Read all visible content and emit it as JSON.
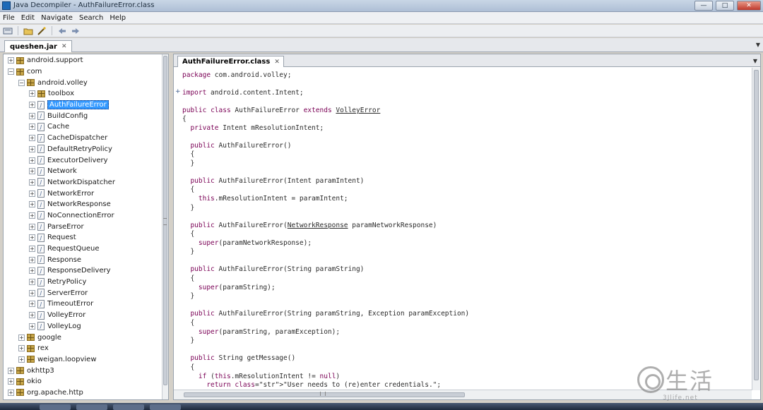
{
  "window": {
    "title": "Java Decompiler - AuthFailureError.class",
    "buttons": [
      "—",
      "□",
      "✕"
    ]
  },
  "menu": [
    "File",
    "Edit",
    "Navigate",
    "Search",
    "Help"
  ],
  "toolbar": {
    "icons": [
      "open-icon",
      "open-folder-icon",
      "wand-icon",
      "back-icon",
      "forward-icon"
    ]
  },
  "jar_tab": {
    "label": "queshen.jar",
    "close": "✕"
  },
  "tree": {
    "rows": [
      {
        "label": "android.support",
        "indent": 0,
        "expander": "+",
        "icon": "pkg"
      },
      {
        "label": "com",
        "indent": 0,
        "expander": "−",
        "icon": "pkg"
      },
      {
        "label": "android.volley",
        "indent": 1,
        "expander": "−",
        "icon": "pkg"
      },
      {
        "label": "toolbox",
        "indent": 2,
        "expander": "+",
        "icon": "pkg"
      },
      {
        "label": "AuthFailureError",
        "indent": 2,
        "expander": "+",
        "icon": "file",
        "selected": true
      },
      {
        "label": "BuildConfig",
        "indent": 2,
        "expander": "+",
        "icon": "file"
      },
      {
        "label": "Cache",
        "indent": 2,
        "expander": "+",
        "icon": "file"
      },
      {
        "label": "CacheDispatcher",
        "indent": 2,
        "expander": "+",
        "icon": "file"
      },
      {
        "label": "DefaultRetryPolicy",
        "indent": 2,
        "expander": "+",
        "icon": "file"
      },
      {
        "label": "ExecutorDelivery",
        "indent": 2,
        "expander": "+",
        "icon": "file"
      },
      {
        "label": "Network",
        "indent": 2,
        "expander": "+",
        "icon": "file"
      },
      {
        "label": "NetworkDispatcher",
        "indent": 2,
        "expander": "+",
        "icon": "file"
      },
      {
        "label": "NetworkError",
        "indent": 2,
        "expander": "+",
        "icon": "file"
      },
      {
        "label": "NetworkResponse",
        "indent": 2,
        "expander": "+",
        "icon": "file"
      },
      {
        "label": "NoConnectionError",
        "indent": 2,
        "expander": "+",
        "icon": "file"
      },
      {
        "label": "ParseError",
        "indent": 2,
        "expander": "+",
        "icon": "file"
      },
      {
        "label": "Request",
        "indent": 2,
        "expander": "+",
        "icon": "file"
      },
      {
        "label": "RequestQueue",
        "indent": 2,
        "expander": "+",
        "icon": "file"
      },
      {
        "label": "Response",
        "indent": 2,
        "expander": "+",
        "icon": "file"
      },
      {
        "label": "ResponseDelivery",
        "indent": 2,
        "expander": "+",
        "icon": "file"
      },
      {
        "label": "RetryPolicy",
        "indent": 2,
        "expander": "+",
        "icon": "file"
      },
      {
        "label": "ServerError",
        "indent": 2,
        "expander": "+",
        "icon": "file"
      },
      {
        "label": "TimeoutError",
        "indent": 2,
        "expander": "+",
        "icon": "file"
      },
      {
        "label": "VolleyError",
        "indent": 2,
        "expander": "+",
        "icon": "file"
      },
      {
        "label": "VolleyLog",
        "indent": 2,
        "expander": "+",
        "icon": "file"
      },
      {
        "label": "google",
        "indent": 1,
        "expander": "+",
        "icon": "pkg"
      },
      {
        "label": "rex",
        "indent": 1,
        "expander": "+",
        "icon": "pkg"
      },
      {
        "label": "weigan.loopview",
        "indent": 1,
        "expander": "+",
        "icon": "pkg"
      },
      {
        "label": "okhttp3",
        "indent": 0,
        "expander": "+",
        "icon": "pkg"
      },
      {
        "label": "okio",
        "indent": 0,
        "expander": "+",
        "icon": "pkg"
      },
      {
        "label": "org.apache.http",
        "indent": 0,
        "expander": "+",
        "icon": "pkg"
      }
    ]
  },
  "editor_tab": {
    "label": "AuthFailureError.class",
    "close": "✕"
  },
  "code": {
    "lines": [
      {
        "row": 0,
        "text": "package com.android.volley;"
      },
      {
        "row": 1,
        "fold": "+",
        "text": "import android.content.Intent;"
      },
      {
        "row": 2,
        "text": "public class AuthFailureError extends VolleyError"
      },
      {
        "row": 3,
        "text": "{"
      },
      {
        "row": 4,
        "text": "  private Intent mResolutionIntent;"
      },
      {
        "row": 5,
        "text": "  public AuthFailureError()"
      },
      {
        "row": 6,
        "text": "  {"
      },
      {
        "row": 7,
        "text": "  }"
      },
      {
        "row": 8,
        "text": "  public AuthFailureError(Intent paramIntent)"
      },
      {
        "row": 9,
        "text": "  {"
      },
      {
        "row": 10,
        "text": "    this.mResolutionIntent = paramIntent;"
      },
      {
        "row": 11,
        "text": "  }"
      },
      {
        "row": 12,
        "text": "  public AuthFailureError(NetworkResponse paramNetworkResponse)"
      },
      {
        "row": 13,
        "text": "  {"
      },
      {
        "row": 14,
        "text": "    super(paramNetworkResponse);"
      },
      {
        "row": 15,
        "text": "  }"
      },
      {
        "row": 16,
        "text": "  public AuthFailureError(String paramString)"
      },
      {
        "row": 17,
        "text": "  {"
      },
      {
        "row": 18,
        "text": "    super(paramString);"
      },
      {
        "row": 19,
        "text": "  }"
      },
      {
        "row": 20,
        "text": "  public AuthFailureError(String paramString, Exception paramException)"
      },
      {
        "row": 21,
        "text": "  {"
      },
      {
        "row": 22,
        "text": "    super(paramString, paramException);"
      },
      {
        "row": 23,
        "text": "  }"
      },
      {
        "row": 24,
        "text": "  public String getMessage()"
      },
      {
        "row": 25,
        "text": "  {"
      },
      {
        "row": 26,
        "text": "    if (this.mResolutionIntent != null)"
      },
      {
        "row": 27,
        "text": "      return \"User needs to (re)enter credentials.\";"
      }
    ]
  },
  "watermark": {
    "text": "生活",
    "sub": "3Jlife.net"
  },
  "colors": {
    "keyword": "#7a0055",
    "string": "#1a3fa0",
    "selection": "#3399ff"
  }
}
